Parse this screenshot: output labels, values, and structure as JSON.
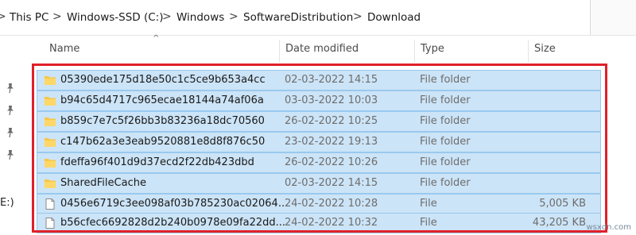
{
  "breadcrumb": {
    "items": [
      "This PC",
      "Windows-SSD (C:)",
      "Windows",
      "SoftwareDistribution",
      "Download"
    ],
    "separator": ">"
  },
  "nav": {
    "drive_fragment": "E:)"
  },
  "columns": {
    "name": "Name",
    "date": "Date modified",
    "type": "Type",
    "size": "Size"
  },
  "rows": [
    {
      "name": "05390ede175d18e50c1c5ce9b653a4cc",
      "date": "02-03-2022 14:15",
      "type": "File folder",
      "size": "",
      "icon": "folder-icon"
    },
    {
      "name": "b94c65d4717c965ecae18144a74af06a",
      "date": "03-03-2022 10:03",
      "type": "File folder",
      "size": "",
      "icon": "folder-icon"
    },
    {
      "name": "b859c7e7c5f26bb3b83236a18dc70560",
      "date": "26-02-2022 10:25",
      "type": "File folder",
      "size": "",
      "icon": "folder-icon"
    },
    {
      "name": "c147b62a3e3eab9520881e8d8f876c50",
      "date": "23-02-2022 19:13",
      "type": "File folder",
      "size": "",
      "icon": "folder-icon"
    },
    {
      "name": "fdeffa96f401d9d37ecd2f22db423dbd",
      "date": "26-02-2022 10:26",
      "type": "File folder",
      "size": "",
      "icon": "folder-icon"
    },
    {
      "name": "SharedFileCache",
      "date": "02-03-2022 14:15",
      "type": "File folder",
      "size": "",
      "icon": "folder-icon"
    },
    {
      "name": "0456e6719c3ee098af03b785230ac02064...",
      "date": "24-02-2022 10:28",
      "type": "File",
      "size": "5,005 KB",
      "icon": "file-icon"
    },
    {
      "name": "b56cfec6692828d2b240b0978e09fa22dd...",
      "date": "24-02-2022 10:32",
      "type": "File",
      "size": "43,205 KB",
      "icon": "file-icon"
    }
  ],
  "selection_color": "#cce4f7",
  "highlight_color": "#e0202a",
  "watermark": "wsxdn.com"
}
